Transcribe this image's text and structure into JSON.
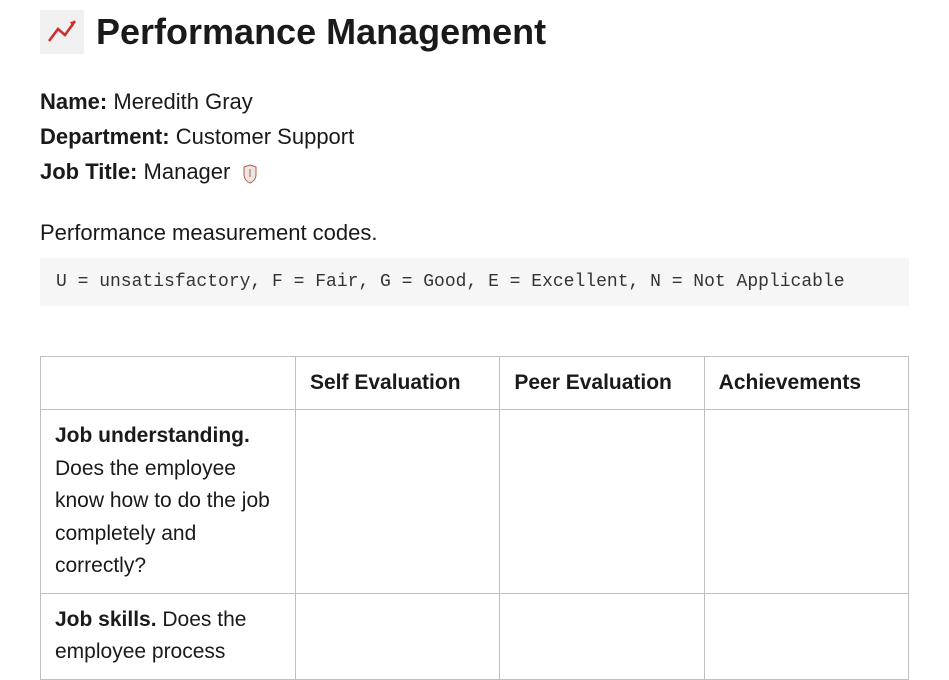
{
  "header": {
    "icon_name": "chart-icon",
    "title": "Performance Management"
  },
  "employee": {
    "name_label": "Name:",
    "name_value": "Meredith Gray",
    "department_label": "Department:",
    "department_value": "Customer Support",
    "job_title_label": "Job Title:",
    "job_title_value": "Manager"
  },
  "codes": {
    "label": "Performance measurement codes.",
    "text": "U = unsatisfactory, F = Fair, G = Good, E = Excellent, N = Not Applicable"
  },
  "table": {
    "columns": [
      "",
      "Self Evaluation",
      "Peer Evaluation",
      "Achievements"
    ],
    "rows": [
      {
        "title": "Job understanding.",
        "desc": "Does the employee know how to do the job completely and correctly?",
        "self": "",
        "peer": "",
        "achievements": ""
      },
      {
        "title": "Job skills.",
        "desc": "Does the employee process",
        "self": "",
        "peer": "",
        "achievements": ""
      }
    ]
  }
}
